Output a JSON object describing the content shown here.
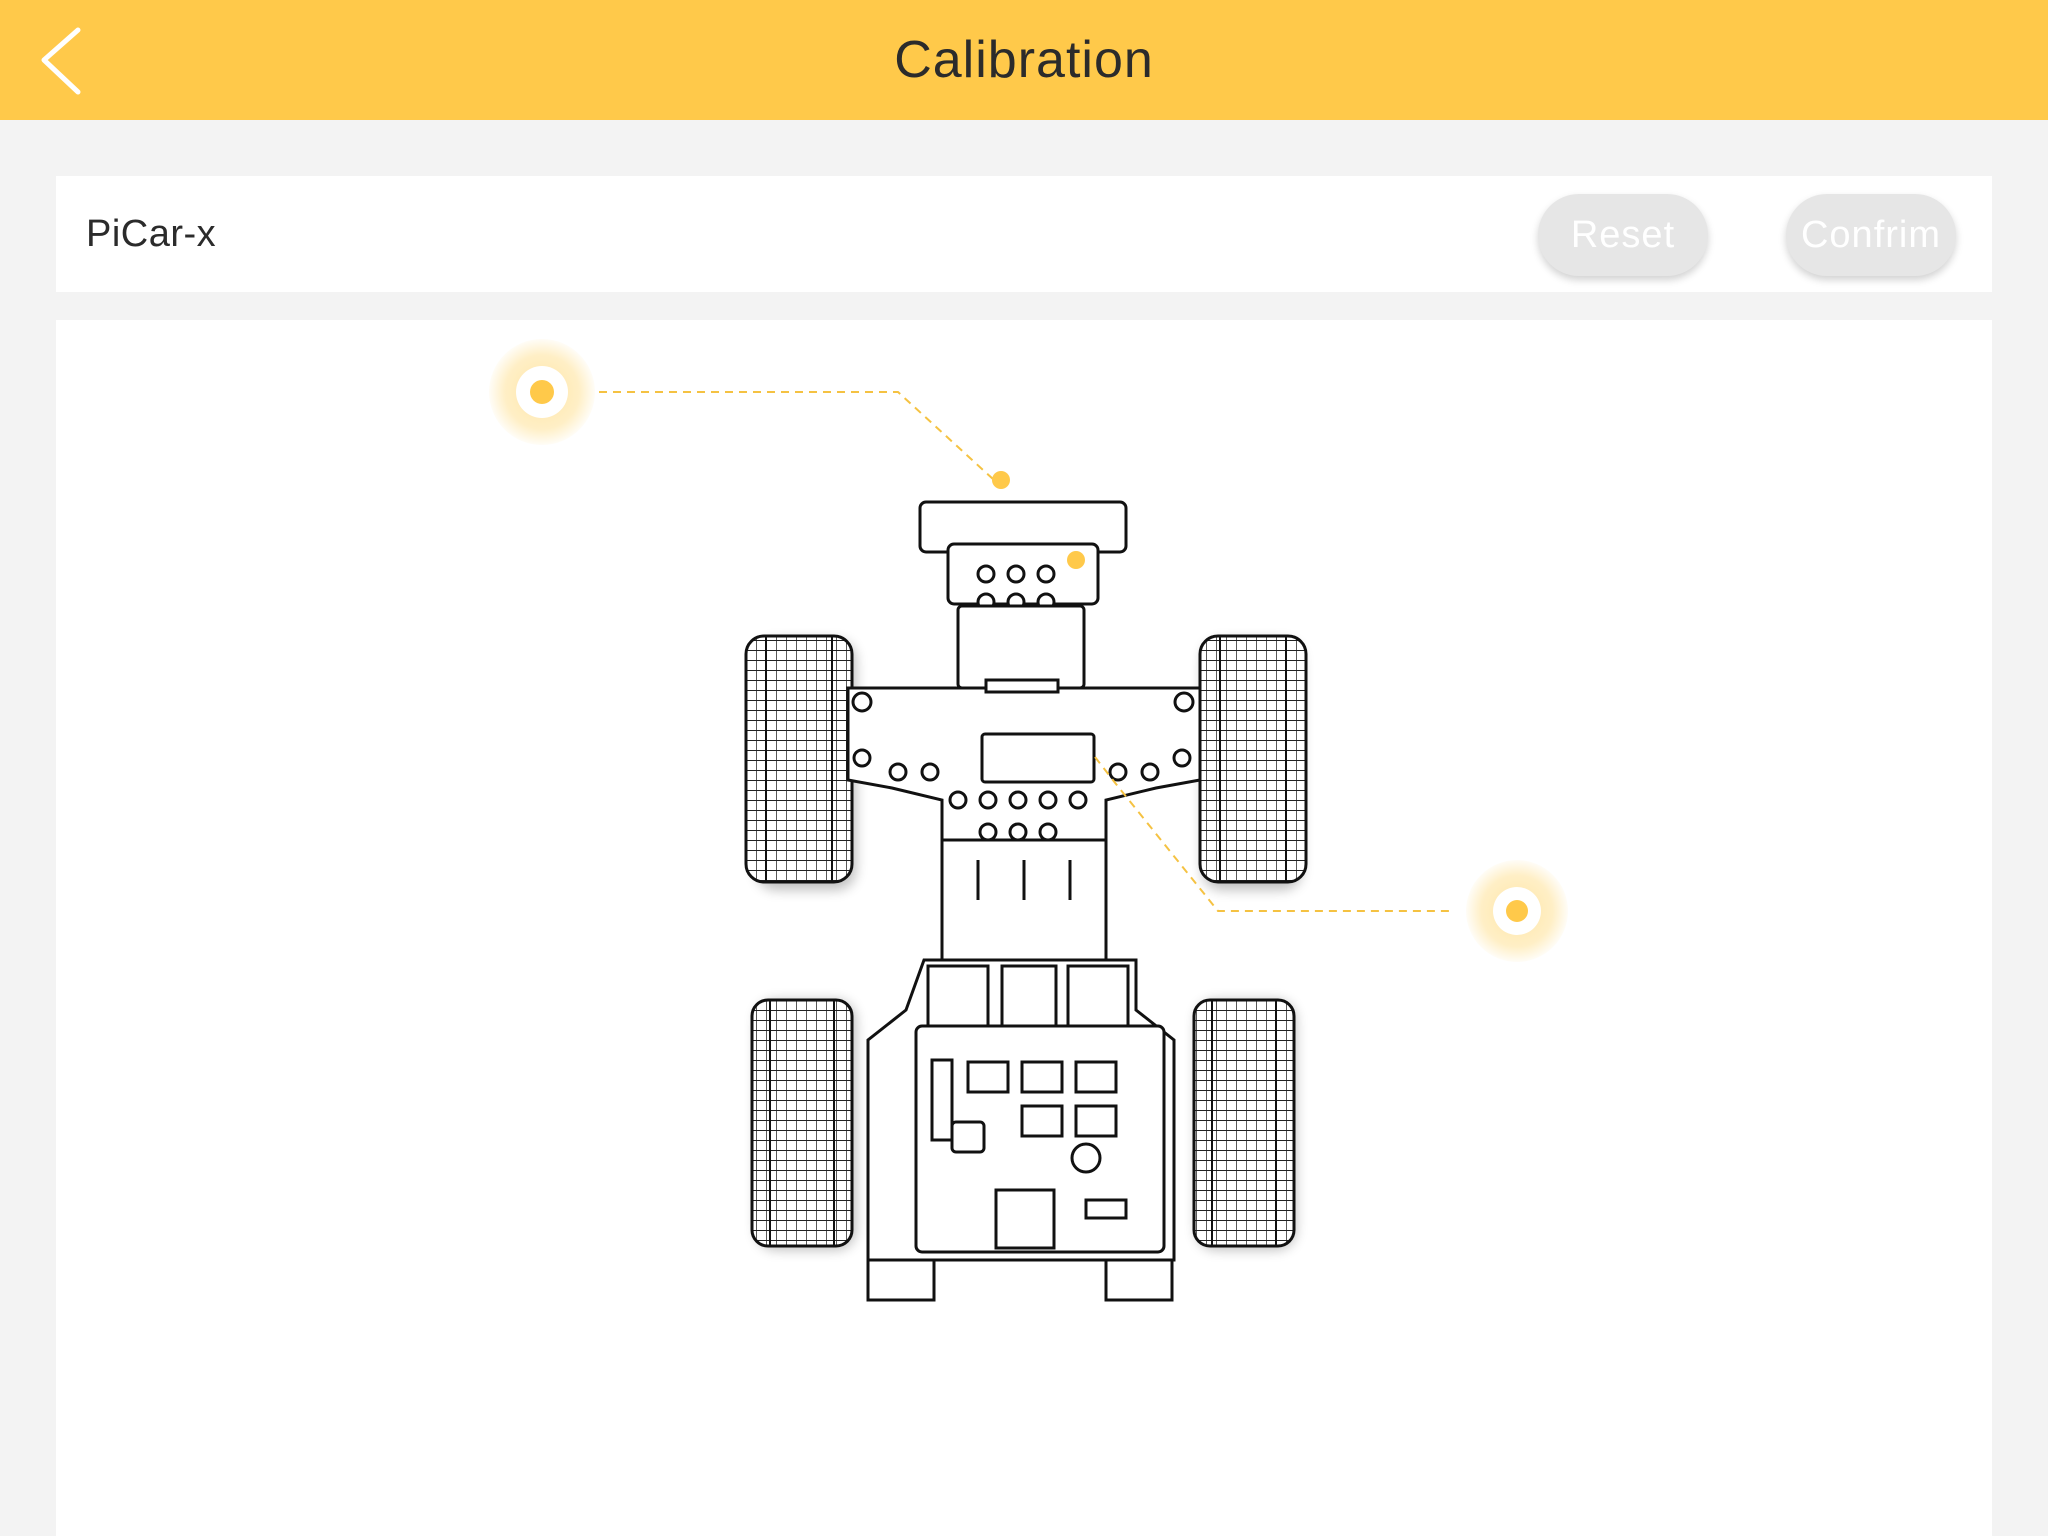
{
  "header": {
    "title": "Calibration",
    "back_icon": "chevron-left-icon"
  },
  "toolbar": {
    "device_name": "PiCar-x",
    "reset_label": "Reset",
    "confirm_label": "Confrim"
  },
  "colors": {
    "header_bg": "#ffc94a",
    "accent": "#ffc94a",
    "button_bg": "#e6e6e6",
    "button_text": "#ffffff",
    "page_bg": "#f3f3f3"
  },
  "calibration_points": [
    {
      "id": "camera-servo",
      "icon": "target-dot-icon"
    },
    {
      "id": "steering-servo",
      "icon": "target-dot-icon"
    }
  ]
}
